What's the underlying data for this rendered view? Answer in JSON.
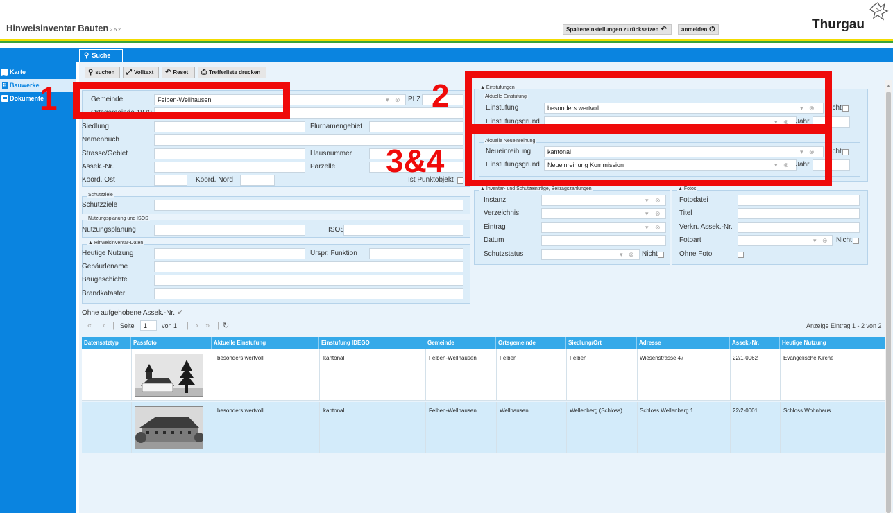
{
  "header": {
    "app_title": "Hinweisinventar Bauten",
    "version": "2.5.2",
    "reset_columns_label": "Spalteneinstellungen zurücksetzen",
    "login_label": "anmelden",
    "logo_text": "Thurgau"
  },
  "colors": {
    "primary_blue": "#0a84e0",
    "table_header_blue": "#35a9e9",
    "panel_bg": "#dcedf9",
    "annotation_red": "#ef0a0a",
    "stripe_yellow": "#f2dc00",
    "stripe_green": "#3aa43a"
  },
  "sidebar": {
    "items": [
      {
        "label": "Karte",
        "icon": "map-icon"
      },
      {
        "label": "Bauwerke",
        "icon": "building-icon"
      },
      {
        "label": "Dokumente",
        "icon": "document-icon"
      }
    ]
  },
  "tab": {
    "label": "Suche",
    "icon": "search-icon"
  },
  "toolbar": {
    "search_label": "suchen",
    "fulltext_label": "Volltext",
    "reset_label": "Reset",
    "print_label": "Trefferliste drucken"
  },
  "annotations": {
    "n1": "1",
    "n2": "2",
    "n34": "3&4"
  },
  "location": {
    "gemeinde_label": "Gemeinde",
    "gemeinde_value": "Felben-Wellhausen",
    "plz_label": "PLZ",
    "ortsgemeinde_label": "Ortsgemeinde 1870",
    "siedlung_label": "Siedlung",
    "flurnamengebiet_label": "Flurnamengebiet",
    "namenbuch_label": "Namenbuch",
    "strasse_label": "Strasse/Gebiet",
    "hausnummer_label": "Hausnummer",
    "assek_label": "Assek.-Nr.",
    "parzelle_label": "Parzelle",
    "koord_ost_label": "Koord. Ost",
    "koord_nord_label": "Koord. Nord",
    "punktobjekt_label": "Ist Punktobjekt"
  },
  "schutzziele": {
    "legend": "Schutzziele",
    "label": "Schutzziele"
  },
  "nutzungsplanung": {
    "legend": "Nutzungsplanung und ISOS",
    "label": "Nutzungsplanung",
    "isos_label": "ISOS"
  },
  "hinweisinventar": {
    "legend": "Hinweisinventar-Daten",
    "heutige_nutzung_label": "Heutige Nutzung",
    "urspr_funktion_label": "Urspr. Funktion",
    "gebaeudename_label": "Gebäudename",
    "baugeschichte_label": "Baugeschichte",
    "brandkataster_label": "Brandkataster"
  },
  "einstufungen": {
    "legend": "Einstufungen",
    "aktuelle_legend": "Aktuelle Einstufung",
    "einstufung_label": "Einstufung",
    "einstufung_value": "besonders wertvoll",
    "einstufungsgrund_label": "Einstufungsgrund",
    "jahr_label": "Jahr",
    "nicht_label": "Nicht",
    "neu_legend": "Aktuelle Neueinreihung",
    "neueinreihung_label": "Neueinreihung",
    "neueinreihung_value": "kantonal",
    "neu_grund_label": "Einstufungsgrund",
    "neu_grund_value": "Neueinreihung Kommission",
    "neu_jahr_label": "Jahr",
    "neu_nicht_label": "Nicht"
  },
  "inventar": {
    "legend": "Inventar- und Schutzeinträge, Beitragszahlungen",
    "instanz_label": "Instanz",
    "verzeichnis_label": "Verzeichnis",
    "eintrag_label": "Eintrag",
    "datum_label": "Datum",
    "schutzstatus_label": "Schutzstatus",
    "nicht_label": "Nicht"
  },
  "fotos": {
    "legend": "Fotos",
    "fotodatei_label": "Fotodatei",
    "titel_label": "Titel",
    "verkn_label": "Verkn. Assek.-Nr.",
    "fotoart_label": "Fotoart",
    "nicht_label": "Nicht",
    "ohne_foto_label": "Ohne Foto"
  },
  "filter": {
    "ohne_aufgehobene_label": "Ohne aufgehobene Assek.-Nr."
  },
  "pager": {
    "seite_label": "Seite",
    "page_value": "1",
    "von_label": "von 1",
    "display_label": "Anzeige Eintrag 1 - 2 von 2"
  },
  "table": {
    "columns": [
      "Datensatztyp",
      "Passfoto",
      "Aktuelle Einstufung",
      "Einstufung IDEGO",
      "Gemeinde",
      "Ortsgemeinde",
      "Siedlung/Ort",
      "Adresse",
      "Assek.-Nr.",
      "Heutige Nutzung"
    ],
    "rows": [
      {
        "einstufung": "besonders wertvoll",
        "idego": "kantonal",
        "gemeinde": "Felben-Wellhausen",
        "ortsgemeinde": "Felben",
        "siedlung": "Felben",
        "adresse": "Wiesenstrasse 47",
        "assek": "22/1-0062",
        "nutzung": "Evangelische Kirche"
      },
      {
        "einstufung": "besonders wertvoll",
        "idego": "kantonal",
        "gemeinde": "Felben-Wellhausen",
        "ortsgemeinde": "Wellhausen",
        "siedlung": "Wellenberg (Schloss)",
        "adresse": "Schloss Wellenberg 1",
        "assek": "22/2-0001",
        "nutzung": "Schloss Wohnhaus"
      }
    ]
  }
}
